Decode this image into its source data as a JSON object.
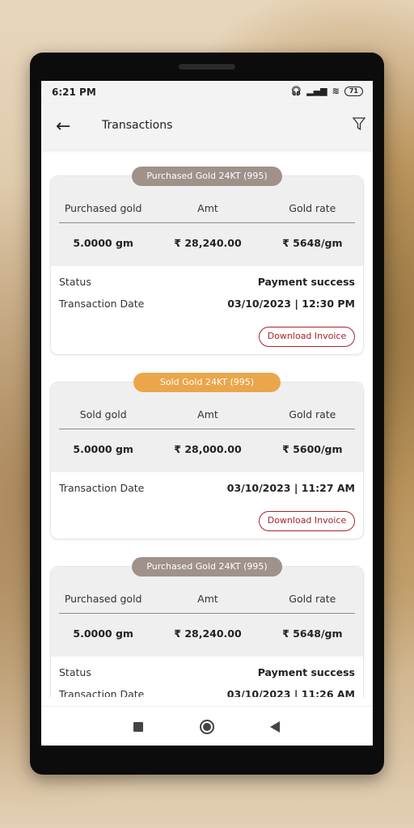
{
  "status_bar": {
    "time": "6:21 PM",
    "battery": "71"
  },
  "header": {
    "title": "Transactions"
  },
  "colors": {
    "purchased_badge": "#a0918a",
    "sold_badge": "#eaa64b",
    "invoice": "#a8232b"
  },
  "transactions": [
    {
      "badge": "Purchased Gold 24KT (995)",
      "type": "purchased",
      "col1": "Purchased gold",
      "col2": "Amt",
      "col3": "Gold rate",
      "qty": "5.0000 gm",
      "amount": "₹ 28,240.00",
      "rate": "₹ 5648/gm",
      "status_label": "Status",
      "status": "Payment success",
      "date_label": "Transaction Date",
      "date": "03/10/2023 | 12:30 PM",
      "invoice": "Download Invoice"
    },
    {
      "badge": "Sold Gold 24KT (995)",
      "type": "sold",
      "col1": "Sold gold",
      "col2": "Amt",
      "col3": "Gold rate",
      "qty": "5.0000 gm",
      "amount": "₹ 28,000.00",
      "rate": "₹ 5600/gm",
      "date_label": "Transaction Date",
      "date": "03/10/2023 | 11:27 AM",
      "invoice": "Download Invoice"
    },
    {
      "badge": "Purchased Gold 24KT (995)",
      "type": "purchased",
      "col1": "Purchased gold",
      "col2": "Amt",
      "col3": "Gold rate",
      "qty": "5.0000 gm",
      "amount": "₹ 28,240.00",
      "rate": "₹ 5648/gm",
      "status_label": "Status",
      "status": "Payment success",
      "date_label": "Transaction Date",
      "date": "03/10/2023 | 11:26 AM"
    }
  ]
}
